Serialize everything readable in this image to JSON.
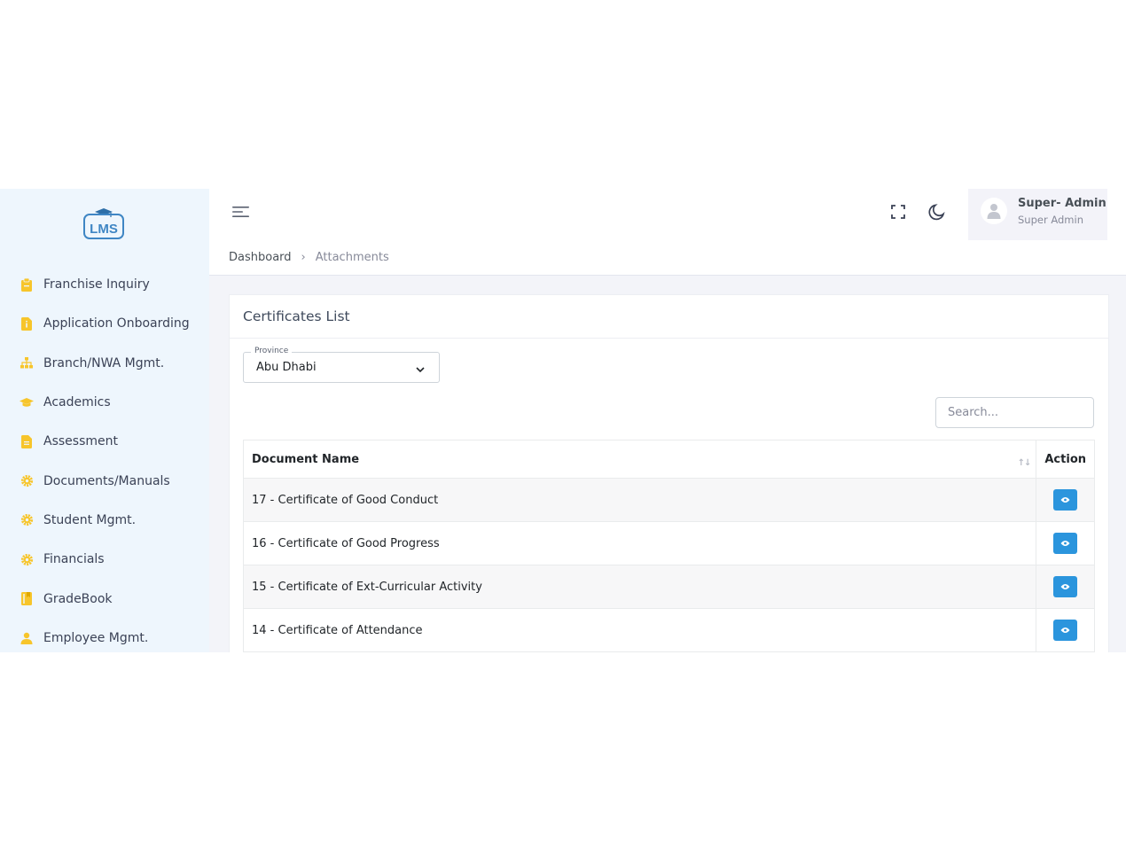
{
  "app": {
    "logo_text": "LMS"
  },
  "sidebar": {
    "items": [
      {
        "label": "Franchise Inquiry",
        "icon": "clipboard-icon"
      },
      {
        "label": "Application Onboarding",
        "icon": "info-document-icon"
      },
      {
        "label": "Branch/NWA Mgmt.",
        "icon": "sitemap-icon"
      },
      {
        "label": "Academics",
        "icon": "graduation-cap-icon"
      },
      {
        "label": "Assessment",
        "icon": "document-icon"
      },
      {
        "label": "Documents/Manuals",
        "icon": "gear-icon"
      },
      {
        "label": "Student Mgmt.",
        "icon": "gear-icon"
      },
      {
        "label": "Financials",
        "icon": "gear-icon"
      },
      {
        "label": "GradeBook",
        "icon": "book-icon"
      },
      {
        "label": "Employee Mgmt.",
        "icon": "user-icon"
      }
    ],
    "icon_color": "#f7c52b"
  },
  "header": {
    "user": {
      "name": "Super- Admin",
      "role": "Super Admin"
    }
  },
  "breadcrumb": {
    "home": "Dashboard",
    "current": "Attachments"
  },
  "card": {
    "title": "Certificates List",
    "province": {
      "label": "Province",
      "value": "Abu Dhabi"
    },
    "search": {
      "placeholder": "Search..."
    },
    "table": {
      "columns": [
        "Document Name",
        "Action"
      ],
      "rows": [
        "17 - Certificate of Good Conduct",
        "16 - Certificate of Good Progress",
        "15 - Certificate of Ext-Curricular Activity",
        "14 - Certificate of Attendance"
      ]
    }
  },
  "colors": {
    "accent": "#2b95dd",
    "sidebar_bg": "#eef6fd"
  }
}
